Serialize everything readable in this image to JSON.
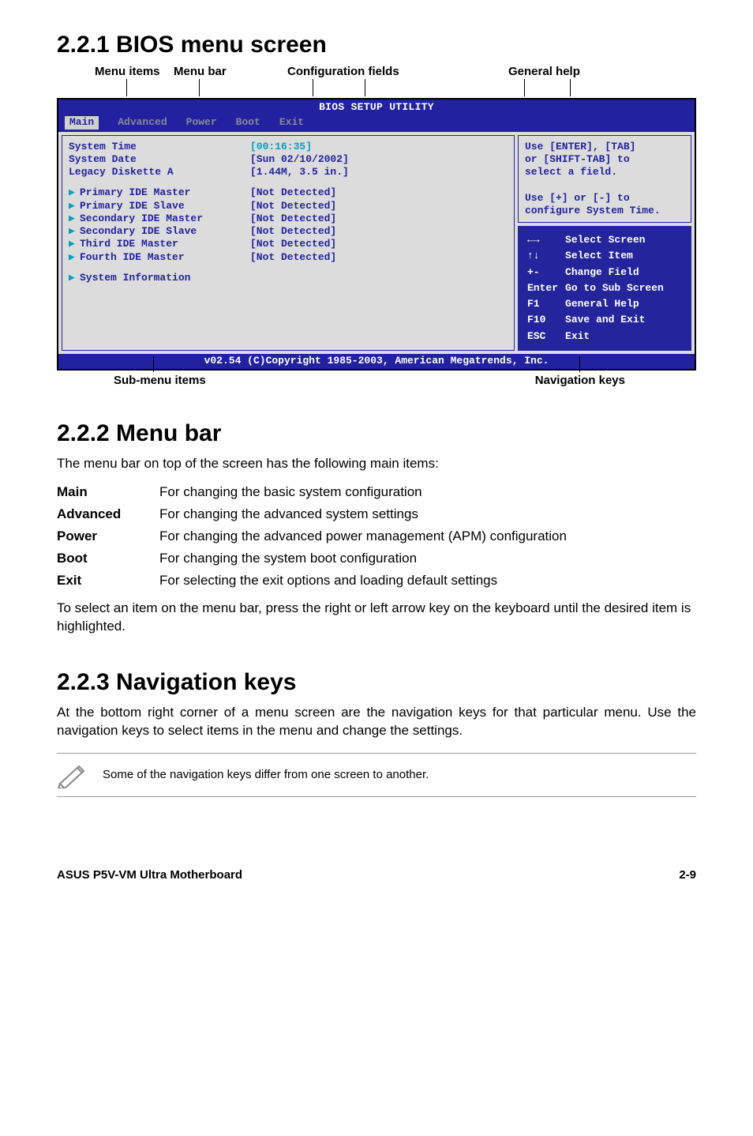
{
  "sec1": {
    "heading": "2.2.1   BIOS menu screen",
    "labels": {
      "menu_items": "Menu items",
      "menu_bar": "Menu bar",
      "config_fields": "Configuration fields",
      "general_help": "General help",
      "sub_menu": "Sub-menu items",
      "nav_keys": "Navigation keys"
    }
  },
  "bios": {
    "title": "BIOS SETUP UTILITY",
    "menubar": [
      "Main",
      "Advanced",
      "Power",
      "Boot",
      "Exit"
    ],
    "rows": [
      {
        "k": "System Time",
        "v": "[00:16:35]",
        "cyan": true
      },
      {
        "k": "System Date",
        "v": "[Sun 02/10/2002]"
      },
      {
        "k": "Legacy Diskette A",
        "v": "[1.44M, 3.5 in.]"
      }
    ],
    "subs": [
      {
        "k": "Primary IDE Master",
        "v": "[Not Detected]"
      },
      {
        "k": "Primary IDE Slave",
        "v": "[Not Detected]"
      },
      {
        "k": "Secondary IDE Master",
        "v": "[Not Detected]"
      },
      {
        "k": "Secondary IDE Slave",
        "v": "[Not Detected]"
      },
      {
        "k": "Third IDE Master",
        "v": "[Not Detected]"
      },
      {
        "k": "Fourth IDE Master",
        "v": "[Not Detected]"
      }
    ],
    "sysinfo": "System Information",
    "help_top": "Use [ENTER], [TAB]\nor [SHIFT-TAB] to\nselect a field.\n\nUse [+] or [-] to\nconfigure System Time.",
    "nav": [
      {
        "k": "←→",
        "v": "Select Screen"
      },
      {
        "k": "↑↓",
        "v": "Select Item"
      },
      {
        "k": "+-",
        "v": "Change Field"
      },
      {
        "k": "Enter",
        "v": "Go to Sub Screen"
      },
      {
        "k": "F1",
        "v": "General Help"
      },
      {
        "k": "F10",
        "v": "Save and Exit"
      },
      {
        "k": "ESC",
        "v": "Exit"
      }
    ],
    "footer": "v02.54 (C)Copyright 1985-2003, American Megatrends, Inc."
  },
  "sec2": {
    "heading": "2.2.2   Menu bar",
    "intro": "The menu bar on top of the screen has the following main items:",
    "rows": [
      {
        "k": "Main",
        "v": "For changing the basic system configuration"
      },
      {
        "k": "Advanced",
        "v": "For changing the advanced system settings"
      },
      {
        "k": "Power",
        "v": "For changing the advanced power management (APM) configuration"
      },
      {
        "k": "Boot",
        "v": "For changing the system boot configuration"
      },
      {
        "k": "Exit",
        "v": "For selecting the exit options and loading default settings"
      }
    ],
    "outro": "To select an item on the menu bar, press the right or left arrow key on the keyboard until the desired item is highlighted."
  },
  "sec3": {
    "heading": "2.2.3   Navigation keys",
    "body": "At the bottom right corner of a menu screen are the navigation keys for that particular menu. Use the navigation keys to select items in the menu and change the settings.",
    "note": "Some of the navigation keys differ from one screen to another."
  },
  "footer": {
    "left": "ASUS P5V-VM Ultra Motherboard",
    "right": "2-9"
  }
}
